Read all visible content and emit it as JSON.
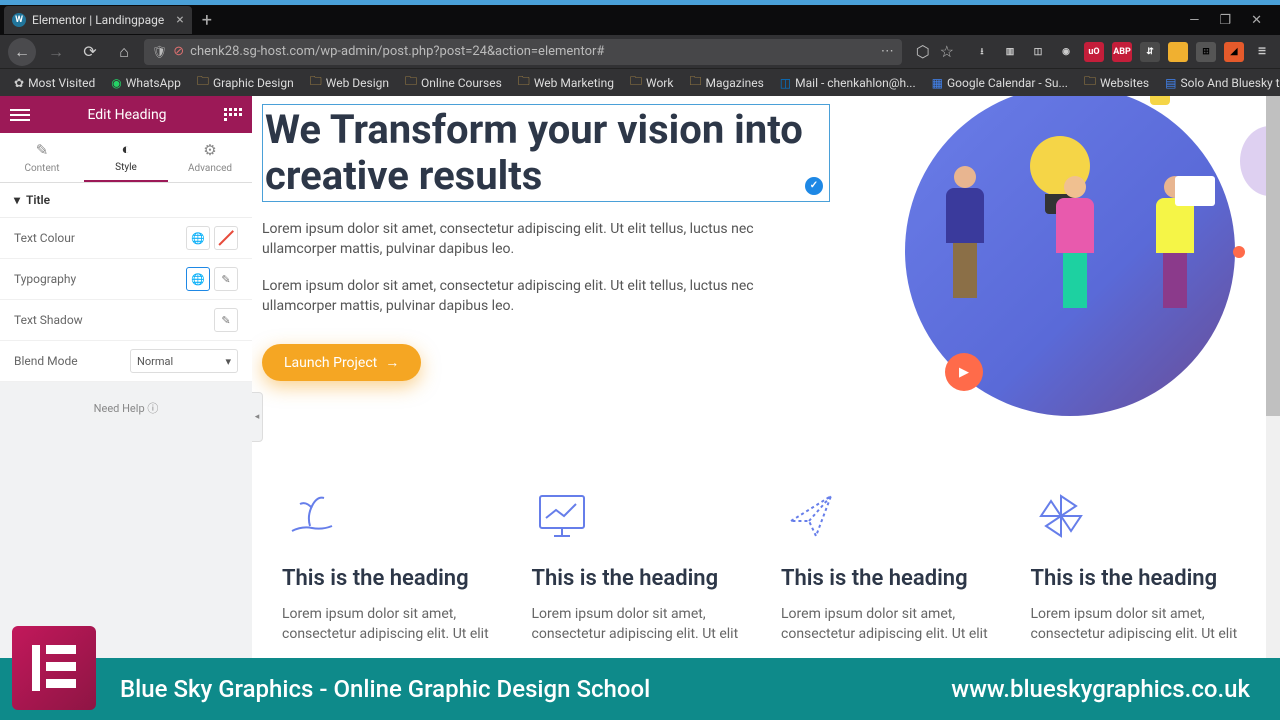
{
  "browser": {
    "tab_title": "Elementor | Landingpage",
    "url": "chenk28.sg-host.com/wp-admin/post.php?post=24&action=elementor#",
    "bookmarks": [
      "Most Visited",
      "WhatsApp",
      "Graphic Design",
      "Web Design",
      "Online Courses",
      "Web Marketing",
      "Work",
      "Magazines",
      "Mail - chenkahlon@h...",
      "Google Calendar - Su...",
      "Websites",
      "Solo And Bluesky task..."
    ]
  },
  "sidebar": {
    "header": "Edit Heading",
    "tabs": {
      "content": "Content",
      "style": "Style",
      "advanced": "Advanced"
    },
    "section": "Title",
    "controls": {
      "text_colour": "Text Colour",
      "typography": "Typography",
      "text_shadow": "Text Shadow",
      "blend_mode": "Blend Mode",
      "blend_value": "Normal"
    },
    "help": "Need Help"
  },
  "page": {
    "hero_title": "We Transform your vision into creative results",
    "hero_p1": "Lorem ipsum dolor sit amet, consectetur adipiscing elit. Ut elit tellus, luctus nec ullamcorper mattis, pulvinar dapibus leo.",
    "hero_p2": "Lorem ipsum dolor sit amet, consectetur adipiscing elit. Ut elit tellus, luctus nec ullamcorper mattis, pulvinar dapibus leo.",
    "cta": "Launch Project",
    "feat_heading": "This is the heading",
    "feat_text": "Lorem ipsum dolor sit amet, consectetur adipiscing elit. Ut elit"
  },
  "banner": {
    "left": "Blue Sky Graphics  - Online Graphic Design School",
    "right": "www.blueskygraphics.co.uk"
  },
  "colors": {
    "accent": "#9c1957",
    "cta": "#f5a623",
    "teal": "#0e8a8a",
    "feat_icon": "#667eea"
  }
}
